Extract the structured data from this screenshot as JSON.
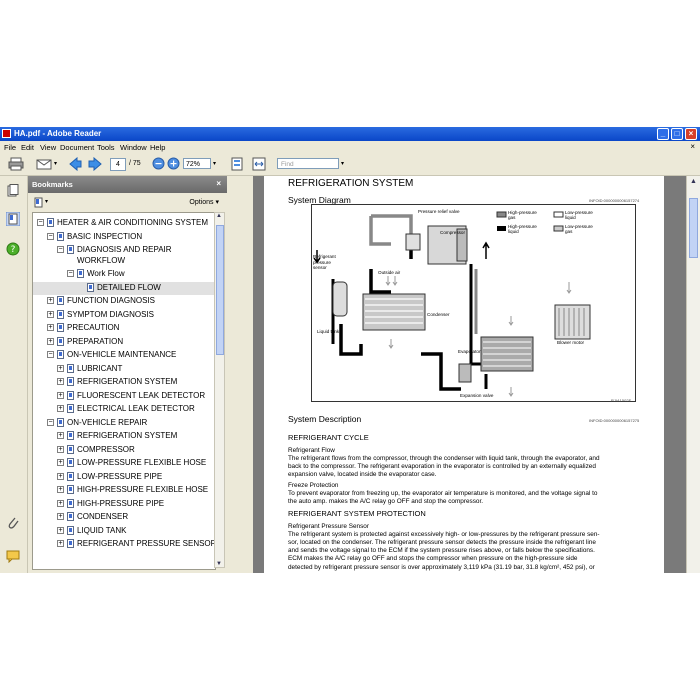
{
  "window": {
    "title": "HA.pdf - Adobe Reader"
  },
  "menus": [
    "File",
    "Edit",
    "View",
    "Document",
    "Tools",
    "Window",
    "Help"
  ],
  "toolbar": {
    "page_current": "4",
    "page_total": "/ 75",
    "zoom": "72%",
    "find_placeholder": "Find"
  },
  "panel": {
    "title": "Bookmarks",
    "options_label": "Options"
  },
  "bookmarks": [
    {
      "label": "HEATER & AIR CONDITIONING SYSTEM",
      "level": 0,
      "toggle": "⊟"
    },
    {
      "label": "BASIC INSPECTION",
      "level": 1,
      "toggle": "⊟"
    },
    {
      "label": "DIAGNOSIS AND REPAIR",
      "label2": "WORKFLOW",
      "level": 2,
      "toggle": "⊟"
    },
    {
      "label": "Work Flow",
      "level": 3,
      "toggle": "⊟"
    },
    {
      "label": "DETAILED FLOW",
      "level": 4,
      "toggle": "",
      "selected": true
    },
    {
      "label": "FUNCTION DIAGNOSIS",
      "level": 1,
      "toggle": "⊞"
    },
    {
      "label": "SYMPTOM DIAGNOSIS",
      "level": 1,
      "toggle": "⊞"
    },
    {
      "label": "PRECAUTION",
      "level": 1,
      "toggle": "⊞"
    },
    {
      "label": "PREPARATION",
      "level": 1,
      "toggle": "⊞"
    },
    {
      "label": "ON-VEHICLE MAINTENANCE",
      "level": 1,
      "toggle": "⊟"
    },
    {
      "label": "LUBRICANT",
      "level": 2,
      "toggle": "⊞"
    },
    {
      "label": "REFRIGERATION SYSTEM",
      "level": 2,
      "toggle": "⊞"
    },
    {
      "label": "FLUORESCENT LEAK DETECTOR",
      "level": 2,
      "toggle": "⊞"
    },
    {
      "label": "ELECTRICAL LEAK DETECTOR",
      "level": 2,
      "toggle": "⊞"
    },
    {
      "label": "ON-VEHICLE REPAIR",
      "level": 1,
      "toggle": "⊟"
    },
    {
      "label": "REFRIGERATION SYSTEM",
      "level": 2,
      "toggle": "⊞"
    },
    {
      "label": "COMPRESSOR",
      "level": 2,
      "toggle": "⊞"
    },
    {
      "label": "LOW-PRESSURE FLEXIBLE HOSE",
      "level": 2,
      "toggle": "⊞"
    },
    {
      "label": "LOW-PRESSURE PIPE",
      "level": 2,
      "toggle": "⊞"
    },
    {
      "label": "HIGH-PRESSURE FLEXIBLE HOSE",
      "level": 2,
      "toggle": "⊞"
    },
    {
      "label": "HIGH-PRESSURE PIPE",
      "level": 2,
      "toggle": "⊞"
    },
    {
      "label": "CONDENSER",
      "level": 2,
      "toggle": "⊞"
    },
    {
      "label": "LIQUID TANK",
      "level": 2,
      "toggle": "⊞"
    },
    {
      "label": "REFRIGERANT PRESSURE SENSOR",
      "level": 2,
      "toggle": "⊞"
    }
  ],
  "doc": {
    "title": "REFRIGERATION SYSTEM",
    "system_diagram": "System Diagram",
    "code1": "INFOID:0000000006157274",
    "diagram": {
      "pressure_relief": "Pressure relief valve",
      "compressor": "Compressor",
      "legend_hp_gas": "High-pressure\ngas",
      "legend_lp_liquid": "Low-pressure\nliquid",
      "legend_hp_liquid": "High-pressure\nliquid",
      "legend_lp_gas": "Low-pressure\ngas",
      "sensor": "Refrigerant\npressure\nsensor",
      "outside_air": "Outside air",
      "condenser": "Condenser",
      "liquid_tank": "Liquid tank",
      "evaporator": "Evaporator",
      "blower": "Blower motor",
      "expansion": "Expansion valve",
      "code": "RJIA1502E"
    },
    "system_description": "System Description",
    "code2": "INFOID:0000000006157275",
    "refrigerant_cycle": "REFRIGERANT CYCLE",
    "refrigerant_flow": "Refrigerant Flow",
    "flow_lines": [
      "The refrigerant flows from the compressor, through the condenser with liquid tank, through the evaporator, and",
      "back to the compressor. The refrigerant evaporation in the evaporator is controlled by an externally equalized",
      "expansion valve, located inside the evaporator case."
    ],
    "freeze_protection": "Freeze Protection",
    "freeze_lines": [
      "To prevent evaporator from freezing up, the evaporator air temperature is monitored, and the voltage signal to",
      "the auto amp. makes the A/C relay go OFF and stop the compressor."
    ],
    "protection": "REFRIGERANT SYSTEM PROTECTION",
    "sensor_heading": "Refrigerant Pressure Sensor",
    "sensor_lines": [
      "The refrigerant system is protected against excessively high- or low-pressures by the refrigerant pressure sen-",
      "sor, located on the condenser. The refrigerant pressure sensor detects the pressure inside the refrigerant line",
      "and sends the voltage signal to the ECM if the system pressure rises above, or falls below the specifications.",
      "ECM makes the A/C relay go OFF and stops the compressor when pressure on the high-pressure side",
      "detected by refrigerant pressure sensor is over approximately 3,119 kPa (31.19 bar, 31.8 kg/cm², 452 psi), or"
    ]
  }
}
